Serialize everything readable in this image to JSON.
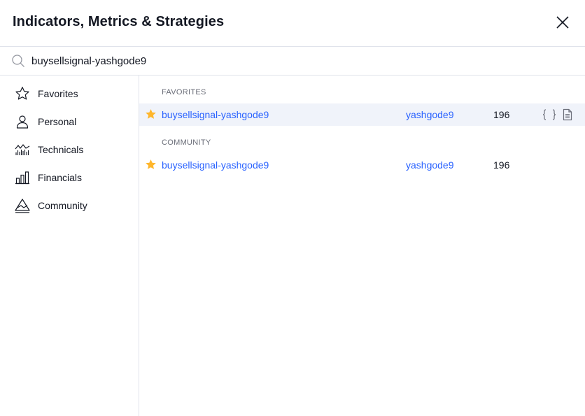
{
  "dialog": {
    "title": "Indicators, Metrics & Strategies"
  },
  "search": {
    "value": "buysellsignal-yashgode9"
  },
  "sidebar": {
    "items": [
      {
        "label": "Favorites",
        "icon": "star-outline-icon"
      },
      {
        "label": "Personal",
        "icon": "user-icon"
      },
      {
        "label": "Technicals",
        "icon": "chart-icon"
      },
      {
        "label": "Financials",
        "icon": "bar-chart-icon"
      },
      {
        "label": "Community",
        "icon": "community-icon"
      }
    ]
  },
  "sections": [
    {
      "title": "FAVORITES",
      "rows": [
        {
          "name": "buysellsignal-yashgode9",
          "author": "yashgode9",
          "count": "196",
          "starred": true,
          "icons": [
            "code-icon",
            "document-icon"
          ]
        }
      ]
    },
    {
      "title": "COMMUNITY",
      "rows": [
        {
          "name": "buysellsignal-yashgode9",
          "author": "yashgode9",
          "count": "196",
          "starred": true
        }
      ]
    }
  ],
  "colors": {
    "link": "#2962ff",
    "star": "#ffb62b",
    "highlight_row": "#f0f3fa",
    "divider": "#e0e3eb"
  }
}
